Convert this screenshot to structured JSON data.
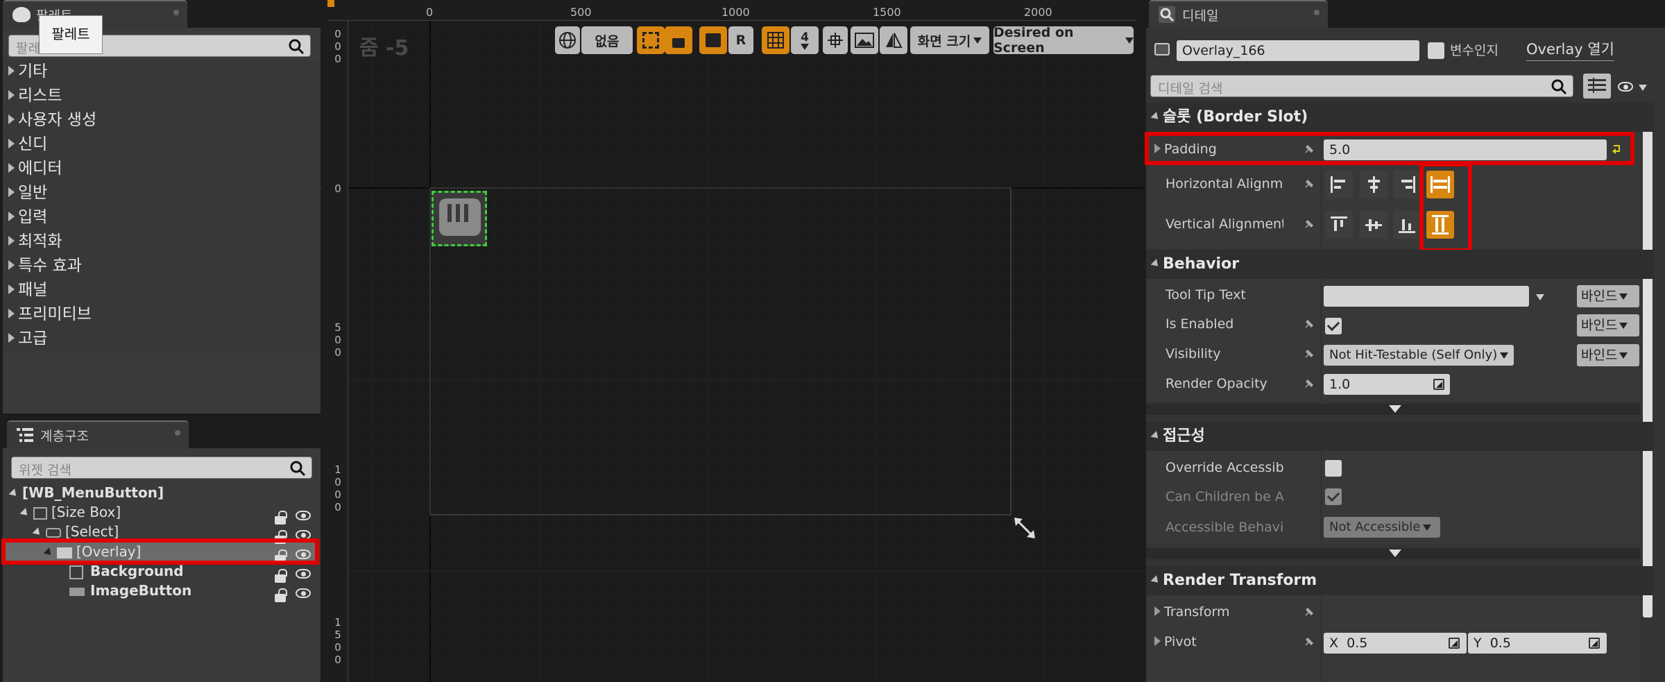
{
  "palette": {
    "tab_label": "팔레트",
    "tooltip": "팔레트",
    "search_placeholder": "팔레",
    "categories": [
      "기타",
      "리스트",
      "사용자 생성",
      "신디",
      "에디터",
      "일반",
      "입력",
      "최적화",
      "특수 효과",
      "패널",
      "프리미티브",
      "고급"
    ]
  },
  "hierarchy": {
    "tab_label": "계층구조",
    "search_placeholder": "위젯 검색",
    "items": [
      {
        "label": "[WB_MenuButton]"
      },
      {
        "label": "[Size Box]"
      },
      {
        "label": "[Select]"
      },
      {
        "label": "[Overlay]"
      },
      {
        "label": "Background"
      },
      {
        "label": "ImageButton"
      }
    ]
  },
  "designer": {
    "zoom_label": "줌 -5",
    "toolbar": {
      "none_label": "없음",
      "r_label": "R",
      "grid_number": "4",
      "screen_size_label": "화면 크기",
      "desired_label": "Desired on Screen"
    },
    "ruler_top": [
      "0",
      "500",
      "1000",
      "1500",
      "2000"
    ],
    "ruler_left": [
      "0",
      "500",
      "1000",
      "1500"
    ]
  },
  "details": {
    "tab_label": "디테일",
    "widget_name": "Overlay_166",
    "is_variable_label": "변수인지",
    "open_overlay_label": "Overlay 열기",
    "search_placeholder": "디테일 검색",
    "sections": {
      "slot": "슬롯 (Border Slot)",
      "behavior": "Behavior",
      "accessibility": "접근성",
      "render_transform": "Render Transform"
    },
    "padding": {
      "label": "Padding",
      "value": "5.0"
    },
    "horizontal_alignment": {
      "label": "Horizontal Alignment"
    },
    "vertical_alignment": {
      "label": "Vertical Alignment"
    },
    "tooltip_text": {
      "label": "Tool Tip Text",
      "value": ""
    },
    "is_enabled": {
      "label": "Is Enabled",
      "checked": true
    },
    "visibility": {
      "label": "Visibility",
      "value": "Not Hit-Testable (Self Only)"
    },
    "render_opacity": {
      "label": "Render Opacity",
      "value": "1.0"
    },
    "override_accessible": {
      "label": "Override Accessible Defau"
    },
    "can_children": {
      "label": "Can Children be Accessib"
    },
    "accessible_behavior": {
      "label": "Accessible Behavior",
      "value": "Not Accessible"
    },
    "transform": {
      "label": "Transform"
    },
    "pivot": {
      "label": "Pivot",
      "x_label": "X",
      "x_value": "0.5",
      "y_label": "Y",
      "y_value": "0.5"
    },
    "bind_label": "바인드"
  },
  "colors": {
    "accent": "#d8860f",
    "highlight": "#e00000",
    "selection": "#3ccf3c"
  }
}
